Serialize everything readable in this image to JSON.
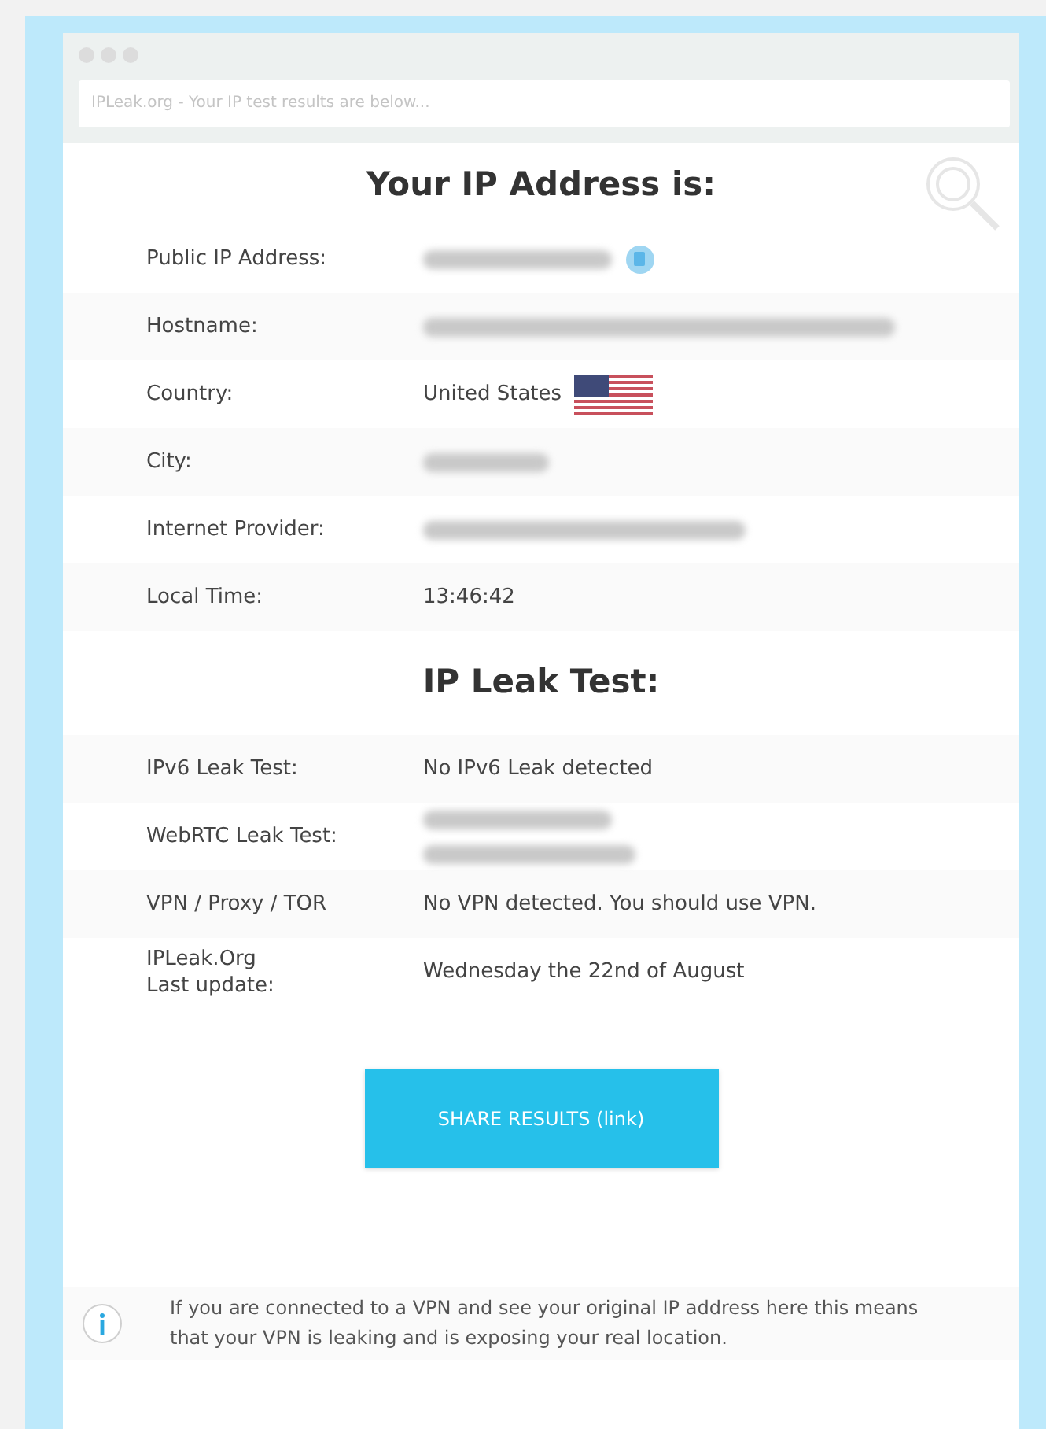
{
  "address_bar": {
    "text": "IPLeak.org - Your IP test results are below..."
  },
  "ip_section": {
    "title": "Your IP Address is:",
    "rows": [
      {
        "label": "Public IP Address:",
        "kind": "redacted",
        "copy_button": true
      },
      {
        "label": "Hostname:",
        "kind": "redacted_long"
      },
      {
        "label": "Country:",
        "kind": "text",
        "value": "United States",
        "flag": true
      },
      {
        "label": "City:",
        "kind": "redacted_short"
      },
      {
        "label": "Internet Provider:",
        "kind": "redacted_mid"
      },
      {
        "label": "Local Time:",
        "kind": "text",
        "value": "13:46:42"
      }
    ]
  },
  "leak_section": {
    "title": "IP Leak Test:",
    "rows": [
      {
        "label": "IPv6 Leak Test:",
        "kind": "text",
        "value": "No IPv6 Leak detected"
      },
      {
        "label": "WebRTC Leak Test:",
        "kind": "redacted_two_line"
      },
      {
        "label": "VPN / Proxy / TOR",
        "kind": "text",
        "value": "No VPN detected. You should use VPN."
      },
      {
        "label": "IPLeak.Org\nLast update:",
        "kind": "text",
        "value": "Wednesday the 22nd of August"
      }
    ]
  },
  "share_button": {
    "label": "SHARE RESULTS (link)"
  },
  "info_note": {
    "text": "If you are connected to a VPN and see your original IP address here this means that your VPN is leaking and is exposing your real location."
  }
}
